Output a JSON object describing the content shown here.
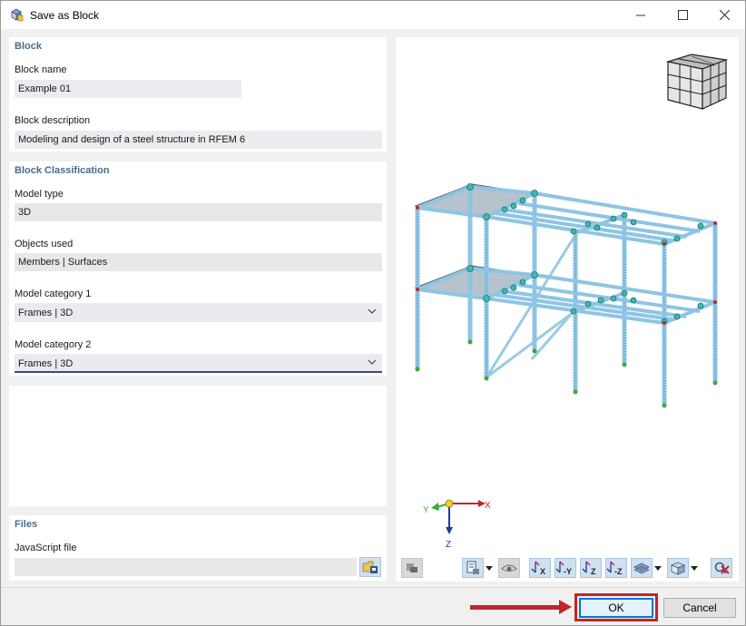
{
  "window": {
    "title": "Save as Block",
    "controls": {
      "minimize": "—",
      "maximize": "☐",
      "close": "✕"
    }
  },
  "block": {
    "section_title": "Block",
    "name_label": "Block name",
    "name_value": "Example 01",
    "description_label": "Block description",
    "description_value": "Modeling and design of a steel structure in RFEM 6"
  },
  "classification": {
    "section_title": "Block Classification",
    "model_type_label": "Model type",
    "model_type_value": "3D",
    "objects_used_label": "Objects used",
    "objects_used_value": "Members | Surfaces",
    "category1_label": "Model category 1",
    "category1_value": "Frames | 3D",
    "category2_label": "Model category 2",
    "category2_value": "Frames | 3D"
  },
  "files": {
    "section_title": "Files",
    "js_label": "JavaScript file",
    "js_value": ""
  },
  "viewport": {
    "axis_x": "X",
    "axis_y": "Y",
    "axis_z": "Z",
    "toolbar": {
      "view_x": "X",
      "view_neg_y": "-Y",
      "view_z": "Z",
      "view_neg_z": "-Z"
    }
  },
  "buttons": {
    "ok": "OK",
    "cancel": "Cancel"
  },
  "colors": {
    "member": "#8ec5e4",
    "member_edge": "#4a8fb8",
    "node": "#3fb8b0",
    "surface": "#a9b8c4",
    "highlight": "#c0262c",
    "section_title": "#4a6a8c"
  }
}
